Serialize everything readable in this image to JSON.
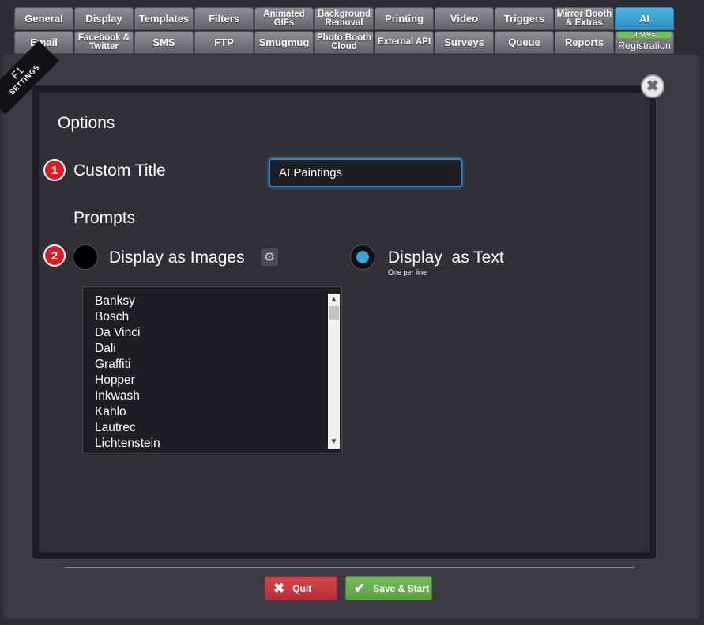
{
  "tabs": {
    "row1": [
      "General",
      "Display",
      "Templates",
      "Filters",
      "Animated\nGIFs",
      "Background\nRemoval",
      "Printing",
      "Video",
      "Triggers",
      "Mirror Booth\n& Extras",
      "AI"
    ],
    "row2": [
      "Email",
      "Facebook &\nTwitter",
      "SMS",
      "FTP",
      "Smugmug",
      "Photo Booth\nCloud",
      "External API",
      "Surveys",
      "Queue",
      "Reports",
      "Registration"
    ],
    "update_badge": "UPDATE",
    "active": "AI"
  },
  "ribbon": {
    "key": "F1",
    "label": "SETTINGS"
  },
  "close_glyph": "✖",
  "section": {
    "options_title": "Options",
    "prompts_title": "Prompts"
  },
  "badges": {
    "one": "1",
    "two": "2"
  },
  "custom_title": {
    "label": "Custom Title",
    "value": "AI Paintings"
  },
  "prompts": {
    "images_label": "Display as Images",
    "text_label": "Display  as Text",
    "text_sublabel": "One per line",
    "selected": "text",
    "items": [
      "Banksy",
      "Bosch",
      "Da Vinci",
      "Dali",
      "Graffiti",
      "Hopper",
      "Inkwash",
      "Kahlo",
      "Lautrec",
      "Lichtenstein"
    ]
  },
  "buttons": {
    "quit": "Quit",
    "save": "Save & Start"
  },
  "colors": {
    "accent": "#3ba3d3",
    "quit": "#c9393f",
    "save": "#6aae4e",
    "badge": "#e01b24"
  }
}
